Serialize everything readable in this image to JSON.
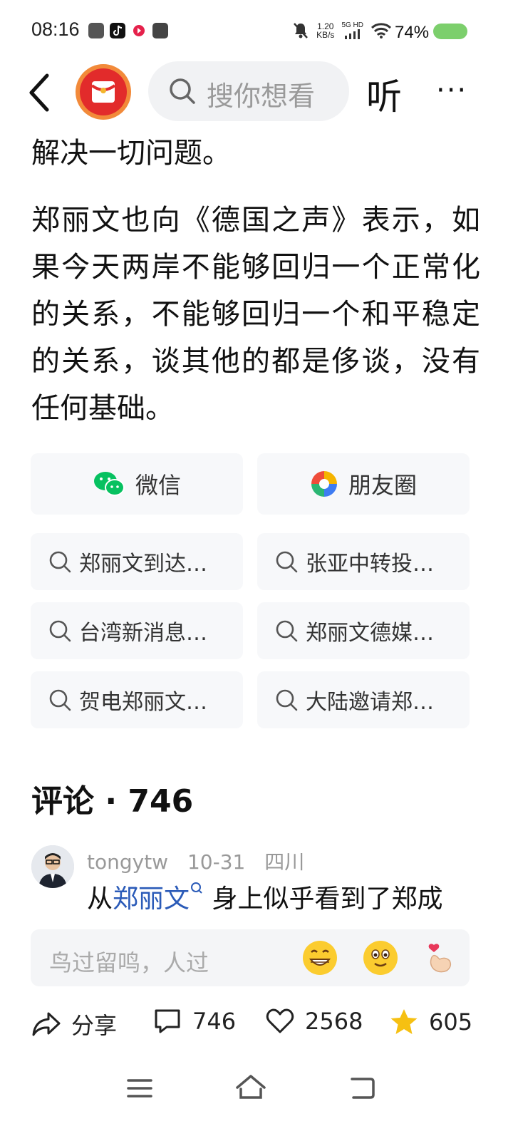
{
  "status_bar": {
    "time": "08:16",
    "net_speed_value": "1.20",
    "net_speed_unit": "KB/s",
    "signal_label": "5G HD",
    "battery_percent": "74%",
    "battery_level": 0.74,
    "battery_color": "#7ccf6c"
  },
  "nav": {
    "search_placeholder": "搜你想看",
    "listen_label": "听",
    "more_label": "···"
  },
  "article": {
    "paragraph_1": "解决一切问题。",
    "paragraph_2": "郑丽文也向《德国之声》表示，如果今天两岸不能够回归一个正常化的关系，不能够回归一个和平稳定的关系，谈其他的都是侈谈，没有任何基础。"
  },
  "share": {
    "wechat_label": "微信",
    "moments_label": "朋友圈"
  },
  "related_searches": [
    "郑丽文到达…",
    "张亚中转投…",
    "台湾新消息…",
    "郑丽文德媒…",
    "贺电郑丽文…",
    "大陆邀请郑…"
  ],
  "comments": {
    "title": "评论 · 746",
    "first": {
      "username": "tongytw",
      "date": "10-31",
      "location": "四川",
      "text_prefix": "从",
      "link_text": "郑丽文",
      "text_suffix": " 身上似乎看到了郑成"
    },
    "input_placeholder": "鸟过留鸣，人过"
  },
  "actions": {
    "share_label": "分享",
    "comment_count": "746",
    "like_count": "2568",
    "favorite_count": "605"
  },
  "colors": {
    "accent_link": "#2b5bb8",
    "star": "#f6c012",
    "wechat_green": "#07c160"
  }
}
